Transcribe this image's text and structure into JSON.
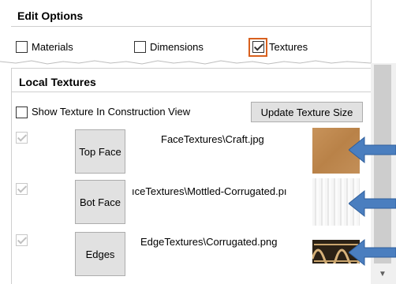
{
  "edit_options": {
    "title": "Edit Options",
    "materials_label": "Materials",
    "dimensions_label": "Dimensions",
    "textures_label": "Textures",
    "materials_checked": false,
    "dimensions_checked": false,
    "textures_checked": true
  },
  "local_textures": {
    "title": "Local Textures",
    "show_texture_label": "Show Texture In Construction View",
    "show_texture_checked": false,
    "update_button": "Update Texture Size",
    "rows": [
      {
        "button": "Top Face",
        "path": "FaceTextures\\Craft.jpg",
        "checked": true,
        "thumbnail": "craft-paper"
      },
      {
        "button": "Bot Face",
        "path": "ıceTextures\\Mottled-Corrugated.pı",
        "checked": true,
        "thumbnail": "mottled-corrugated"
      },
      {
        "button": "Edges",
        "path": "EdgeTextures\\Corrugated.png",
        "checked": true,
        "thumbnail": "corrugated-edge"
      }
    ]
  },
  "colors": {
    "focus_orange": "#d8601e",
    "arrow_blue": "#4a7ebf",
    "craft_brown": "#c08a52"
  },
  "icons": [
    "checkbox-icon",
    "checkmark-icon",
    "blue-arrow-icon",
    "scroll-down-arrow-icon"
  ]
}
